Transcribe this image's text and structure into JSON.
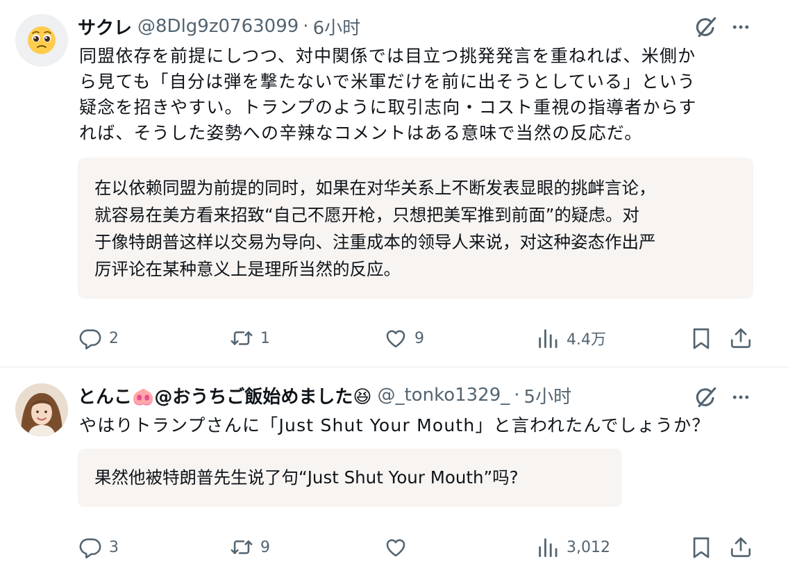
{
  "posts": [
    {
      "name": "サクレ",
      "handle": "@8Dlg9z0763099",
      "separator": "·",
      "time": "6小时",
      "avatar_emoji": "🥺",
      "text_lines": [
        "同盟依存を前提にしつつ、対中関係では目立つ挑発発言を重ねれば、米側か",
        "ら見ても「自分は弾を撃たないで米軍だけを前に出そうとしている」という",
        "疑念を招きやすい。トランプのように取引志向・コスト重視の指導者からす",
        "れば、そうした姿勢への辛辣なコメントはある意味で当然の反応だ。"
      ],
      "translation_lines": [
        "在以依赖同盟为前提的同时，如果在对华关系上不断发表显眼的挑衅言论，",
        "就容易在美方看来招致“自己不愿开枪，只想把美军推到前面”的疑虑。对",
        "于像特朗普这样以交易为导向、注重成本的领导人来说，对这种姿态作出严",
        "厉评论在某种意义上是理所当然的反应。"
      ],
      "actions": {
        "replies": "2",
        "reposts": "1",
        "likes": "9",
        "views": "4.4万"
      }
    },
    {
      "name": "とんこ🐽@おうちご飯始めました😆",
      "handle": "@_tonko1329_",
      "separator": "·",
      "time": "5小时",
      "text": "やはりトランプさんに「Just Shut Your Mouth」と言われたんでしょうか？",
      "translation": "果然他被特朗普先生说了句“Just Shut Your Mouth”吗?",
      "actions": {
        "replies": "3",
        "reposts": "9",
        "likes": "",
        "views": "3,012"
      }
    }
  ],
  "colors": {
    "text": "#0f1419",
    "secondary": "#536471",
    "translation_bg": "#f7f4f2",
    "divider": "#e6e9eb"
  },
  "icons": [
    "reply-icon",
    "repost-icon",
    "like-icon",
    "views-icon",
    "bookmark-icon",
    "share-icon",
    "grok-icon",
    "more-icon"
  ]
}
